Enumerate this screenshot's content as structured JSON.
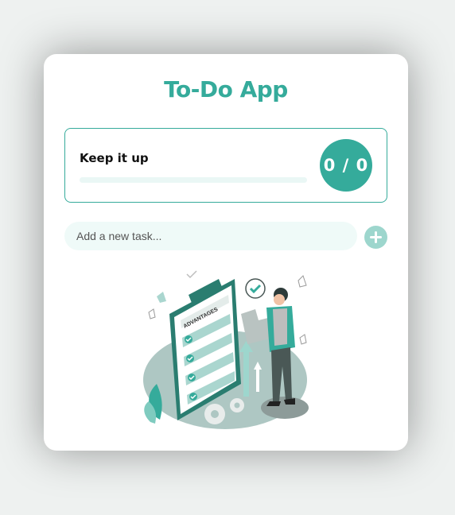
{
  "app": {
    "title": "To-Do App"
  },
  "progress": {
    "label": "Keep it up",
    "completed": 0,
    "total": 0,
    "counter_text": "0 / 0",
    "fraction": 0
  },
  "new_task": {
    "placeholder": "Add a new task...",
    "value": "",
    "add_icon": "plus-icon"
  },
  "illustration": {
    "clipboard_heading": "ADVANTAGES"
  },
  "colors": {
    "accent": "#35ab9b",
    "accent_light": "#9dd6cd",
    "input_bg": "#effaf8",
    "page_bg": "#eef1f0"
  }
}
